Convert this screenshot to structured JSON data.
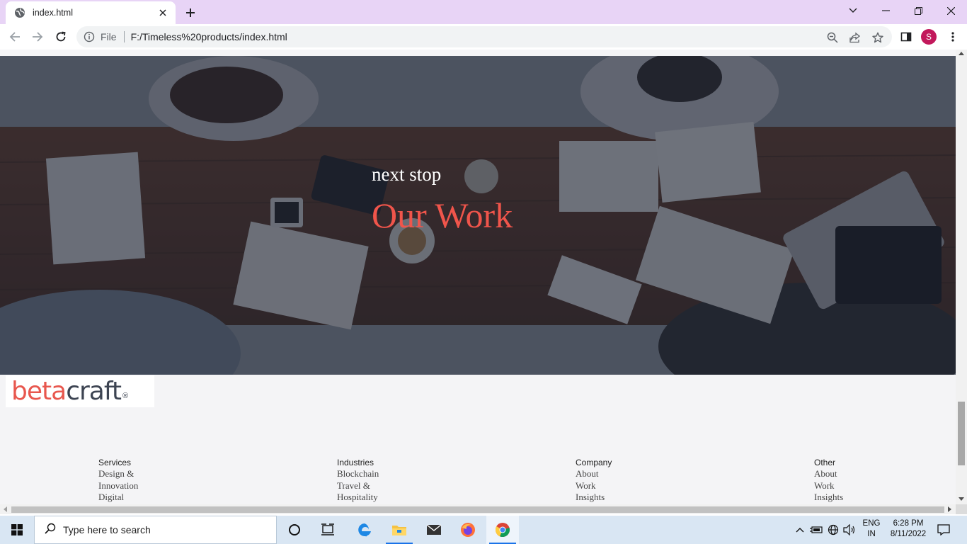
{
  "browser": {
    "tab_title": "index.html",
    "omnibox": {
      "scheme_label": "File",
      "url": "F:/Timeless%20products/index.html"
    },
    "profile_initial": "S"
  },
  "page": {
    "hero": {
      "subtitle": "next stop",
      "title": "Our Work"
    },
    "logo": {
      "part1": "betacraft",
      "brand_color_beta": "#e8574e",
      "brand_color_craft": "#3d4452",
      "registered_mark": "®"
    },
    "footer": {
      "columns": [
        {
          "heading": "Services",
          "links": [
            "Design &",
            "Innovation",
            "Digital"
          ]
        },
        {
          "heading": "Industries",
          "links": [
            "Blockchain",
            "Travel &",
            "Hospitality"
          ]
        },
        {
          "heading": "Company",
          "links": [
            "About",
            "Work",
            "Insights"
          ]
        },
        {
          "heading": "Other",
          "links": [
            "About",
            "Work",
            "Insights"
          ]
        }
      ]
    }
  },
  "taskbar": {
    "search_placeholder": "Type here to search",
    "language": {
      "line1": "ENG",
      "line2": "IN"
    },
    "clock": {
      "time": "6:28 PM",
      "date": "8/11/2022"
    }
  }
}
